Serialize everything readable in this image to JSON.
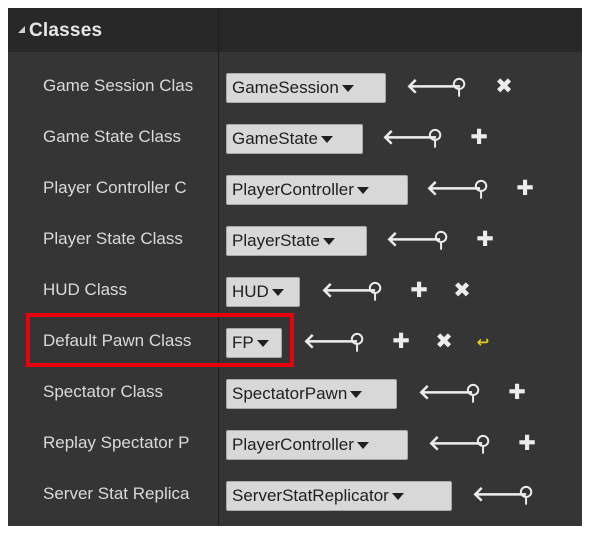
{
  "section": {
    "title": "Classes"
  },
  "rows": [
    {
      "label": "Game Session Clas",
      "value": "GameSession"
    },
    {
      "label": "Game State Class",
      "value": "GameState"
    },
    {
      "label": "Player Controller C",
      "value": "PlayerController"
    },
    {
      "label": "Player State Class",
      "value": "PlayerState"
    },
    {
      "label": "HUD Class",
      "value": "HUD"
    },
    {
      "label": "Default Pawn Class",
      "value": "FP",
      "highlighted": true
    },
    {
      "label": "Spectator Class",
      "value": "SpectatorPawn"
    },
    {
      "label": "Replay Spectator P",
      "value": "PlayerController"
    },
    {
      "label": "Server Stat Replica",
      "value": "ServerStatReplicator"
    }
  ],
  "icons": {
    "browse": "arrow-left-icon",
    "find": "magnifier-icon",
    "new": "plus-icon",
    "clear": "x-icon",
    "reset": "reset-to-default-icon"
  },
  "colors": {
    "highlight": "#e8000e",
    "reset_icon": "#e8d020",
    "panel": "#353535",
    "header": "#282828"
  }
}
